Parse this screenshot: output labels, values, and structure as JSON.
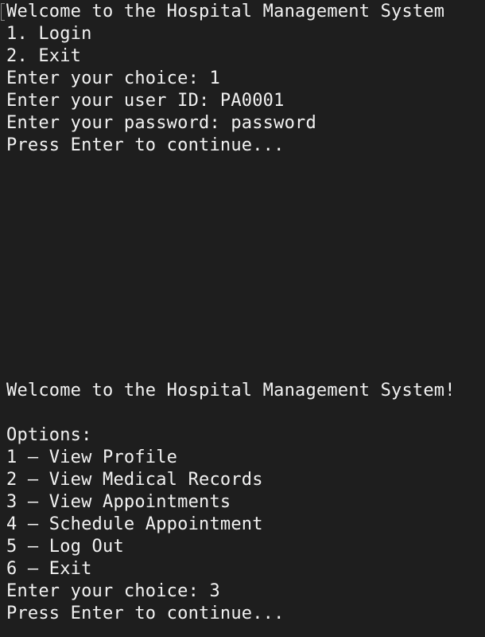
{
  "theme": {
    "background": "#1e1e1e",
    "text": "#f2f2f2"
  },
  "session1": {
    "lines": [
      "Welcome to the Hospital Management System",
      "1. Login",
      "2. Exit",
      "Enter your choice: 1",
      "Enter your user ID: PA0001",
      "Enter your password: password",
      "Press Enter to continue..."
    ]
  },
  "session2": {
    "lines": [
      "Welcome to the Hospital Management System!",
      "",
      "Options:",
      "1 – View Profile",
      "2 – View Medical Records",
      "3 – View Appointments",
      "4 – Schedule Appointment",
      "5 – Log Out",
      "6 – Exit",
      "Enter your choice: 3",
      "Press Enter to continue..."
    ]
  }
}
